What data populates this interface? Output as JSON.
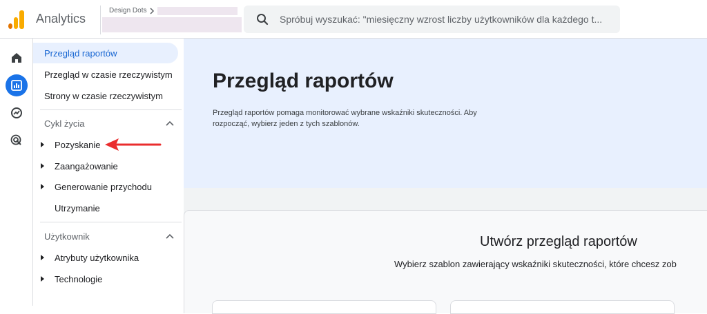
{
  "app": {
    "title": "Analytics"
  },
  "account": {
    "label": "Design Dots"
  },
  "search": {
    "placeholder": "Spróbuj wyszukać: \"miesięczny wzrost liczby użytkowników dla każdego t..."
  },
  "sidebar": {
    "top_items": [
      {
        "label": "Przegląd raportów",
        "active": true
      },
      {
        "label": "Przegląd w czasie rzeczywistym"
      },
      {
        "label": "Strony w czasie rzeczywistym"
      }
    ],
    "sections": [
      {
        "title": "Cykl życia",
        "items": [
          {
            "label": "Pozyskanie",
            "expandable": true
          },
          {
            "label": "Zaangażowanie",
            "expandable": true
          },
          {
            "label": "Generowanie przychodu",
            "expandable": true
          },
          {
            "label": "Utrzymanie",
            "expandable": false
          }
        ]
      },
      {
        "title": "Użytkownik",
        "items": [
          {
            "label": "Atrybuty użytkownika",
            "expandable": true
          },
          {
            "label": "Technologie",
            "expandable": true
          }
        ]
      }
    ]
  },
  "main": {
    "title": "Przegląd raportów",
    "description": "Przegląd raportów pomaga monitorować wybrane wskaźniki skuteczności. Aby rozpocząć, wybierz jeden z tych szablonów.",
    "card_title": "Utwórz przegląd raportów",
    "card_subtitle": "Wybierz szablon zawierający wskaźniki skuteczności, które chcesz zob"
  },
  "colors": {
    "accent": "#1a73e8",
    "arrow": "#ea2d2e",
    "hero_bg": "#e8f0fe"
  }
}
